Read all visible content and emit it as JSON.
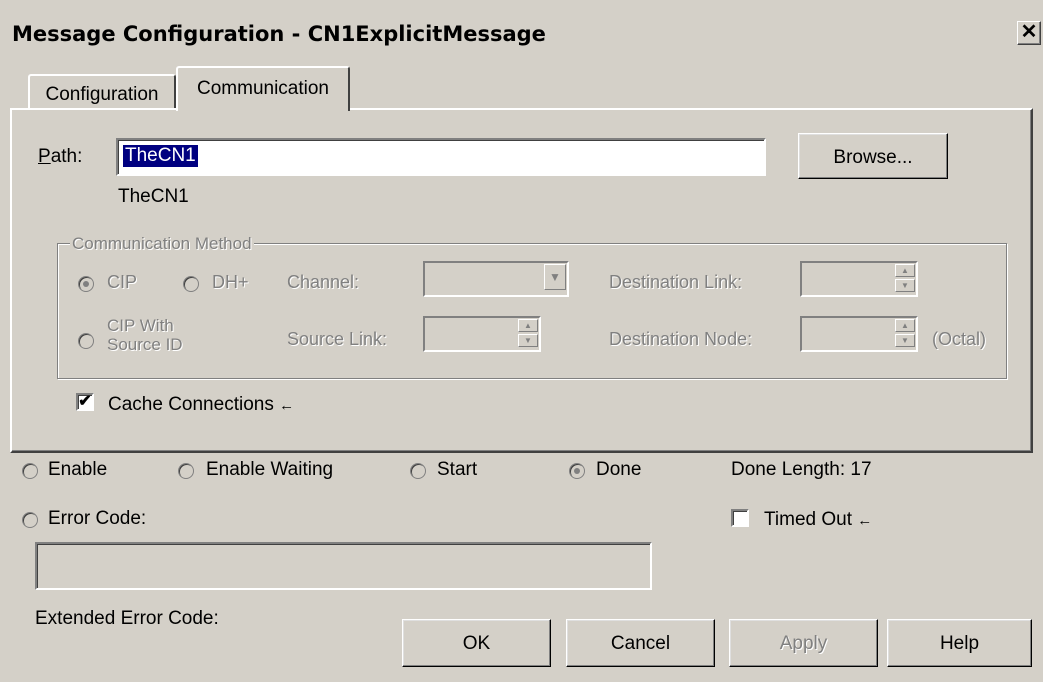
{
  "window": {
    "title": "Message Configuration - CN1ExplicitMessage",
    "close_glyph": "✕"
  },
  "tabs": [
    {
      "label": "Configuration",
      "selected": false
    },
    {
      "label": "Communication",
      "selected": true
    }
  ],
  "path": {
    "label": "Path:",
    "value": "TheCN1",
    "resolved": "TheCN1",
    "browse_label": "Browse..."
  },
  "comm_method": {
    "group_label": "Communication Method",
    "cip_label": "CIP",
    "dhplus_label": "DH+",
    "cip_with_label_1": "CIP With",
    "cip_with_label_2": "Source ID",
    "channel_label": "Channel:",
    "source_link_label": "Source Link:",
    "dest_link_label": "Destination Link:",
    "dest_node_label": "Destination Node:",
    "octal_label": "(Octal)",
    "selected": "CIP"
  },
  "cache": {
    "label": "Cache Connections",
    "arrow": "←",
    "checked": true
  },
  "status": {
    "enable": "Enable",
    "enable_waiting": "Enable Waiting",
    "start": "Start",
    "done": "Done",
    "done_length": "Done Length: 17",
    "error_code": "Error Code:",
    "timed_out": "Timed Out",
    "timed_out_arrow": "←",
    "extended_error": "Extended Error Code:",
    "active": "Done"
  },
  "buttons": {
    "ok": "OK",
    "cancel": "Cancel",
    "apply": "Apply",
    "help": "Help"
  },
  "icons": [
    "close-icon",
    "dropdown-arrow-icon",
    "spin-up-icon",
    "spin-down-icon",
    "arrow-left-icon",
    "checkmark-icon"
  ]
}
